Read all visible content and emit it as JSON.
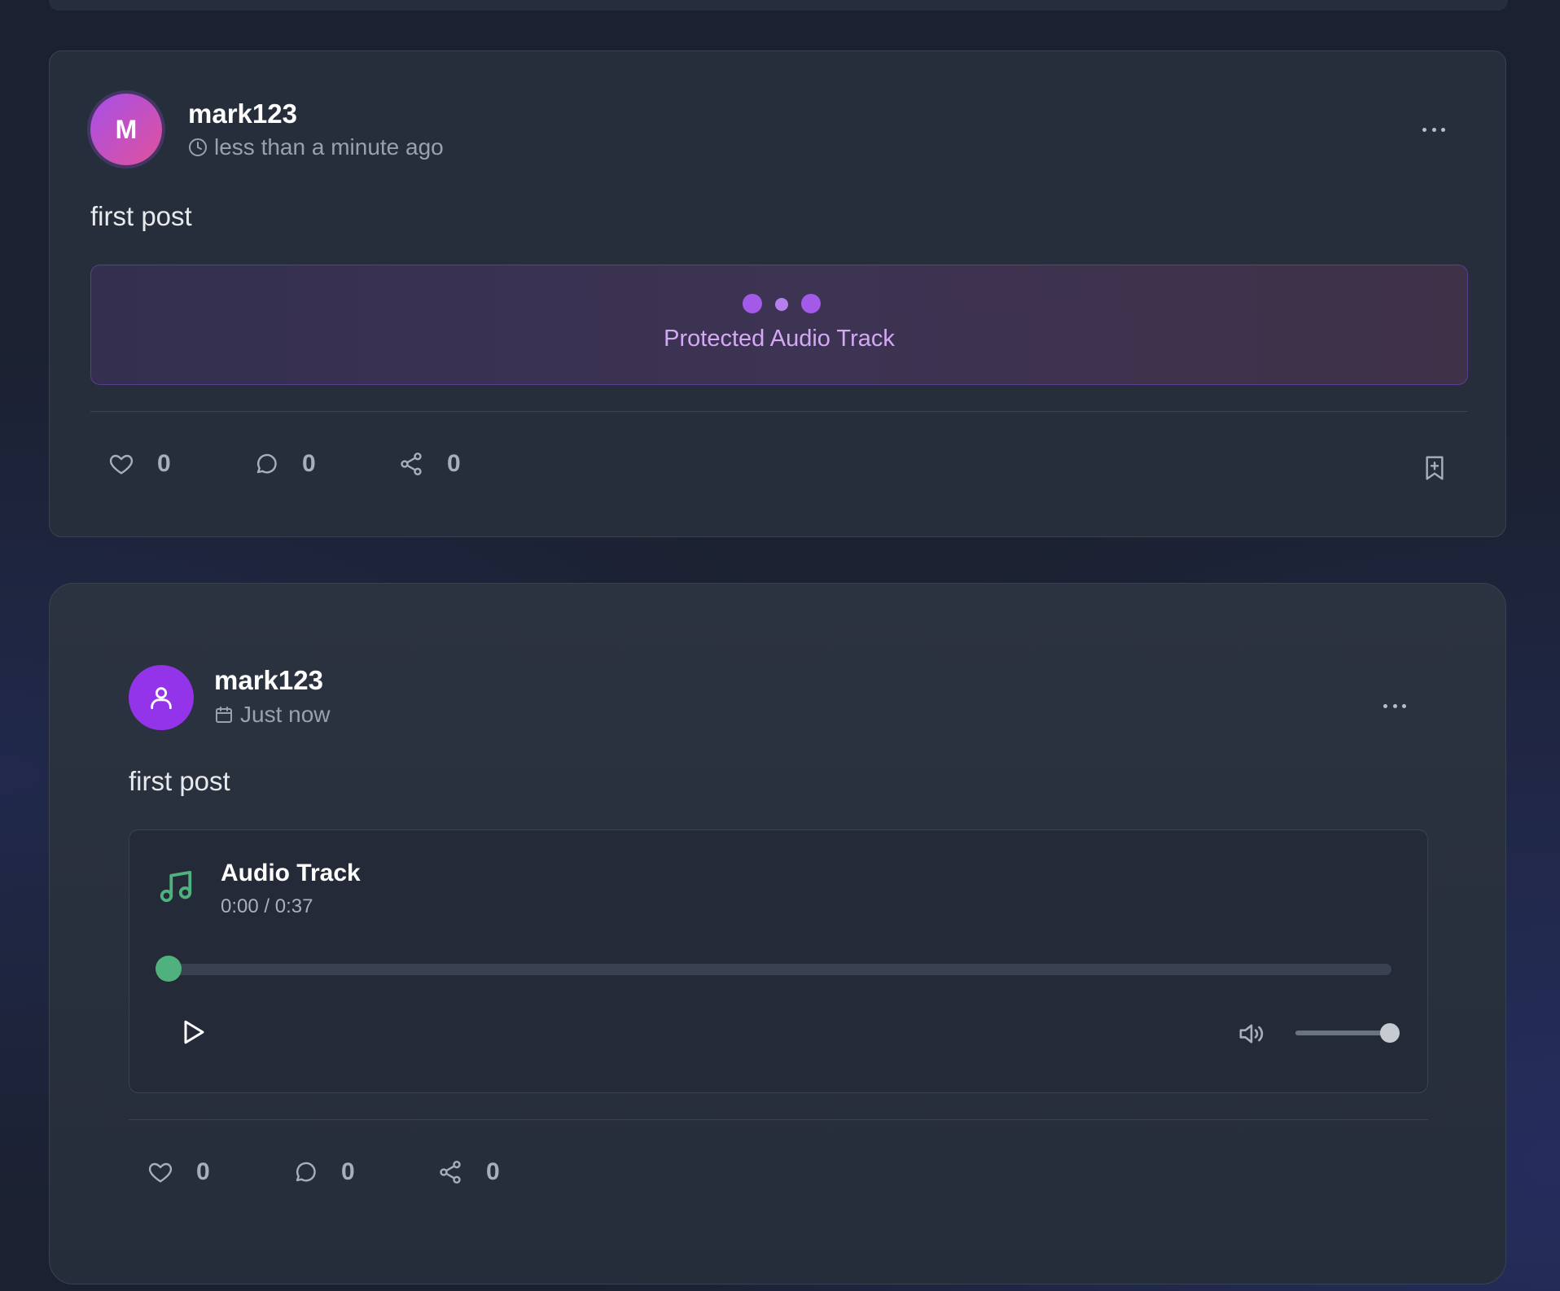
{
  "posts": [
    {
      "avatar_initial": "M",
      "username": "mark123",
      "timestamp": "less than a minute ago",
      "text": "first post",
      "protected_label": "Protected Audio Track",
      "likes": "0",
      "comments": "0",
      "shares": "0"
    },
    {
      "username": "mark123",
      "timestamp": "Just now",
      "text": "first post",
      "audio": {
        "title": "Audio Track",
        "time": "0:00 / 0:37",
        "progress": 0,
        "volume": 1.0
      },
      "likes": "0",
      "comments": "0",
      "shares": "0"
    }
  ],
  "colors": {
    "accent_purple": "#9333ea",
    "audio_green": "#4fb27e",
    "card_bg": "#272e3b"
  },
  "icons": [
    "clock-icon",
    "calendar-icon",
    "more-icon",
    "heart-icon",
    "comment-icon",
    "share-icon",
    "bookmark-plus-icon",
    "user-icon",
    "music-note-icon",
    "play-icon",
    "volume-icon"
  ]
}
